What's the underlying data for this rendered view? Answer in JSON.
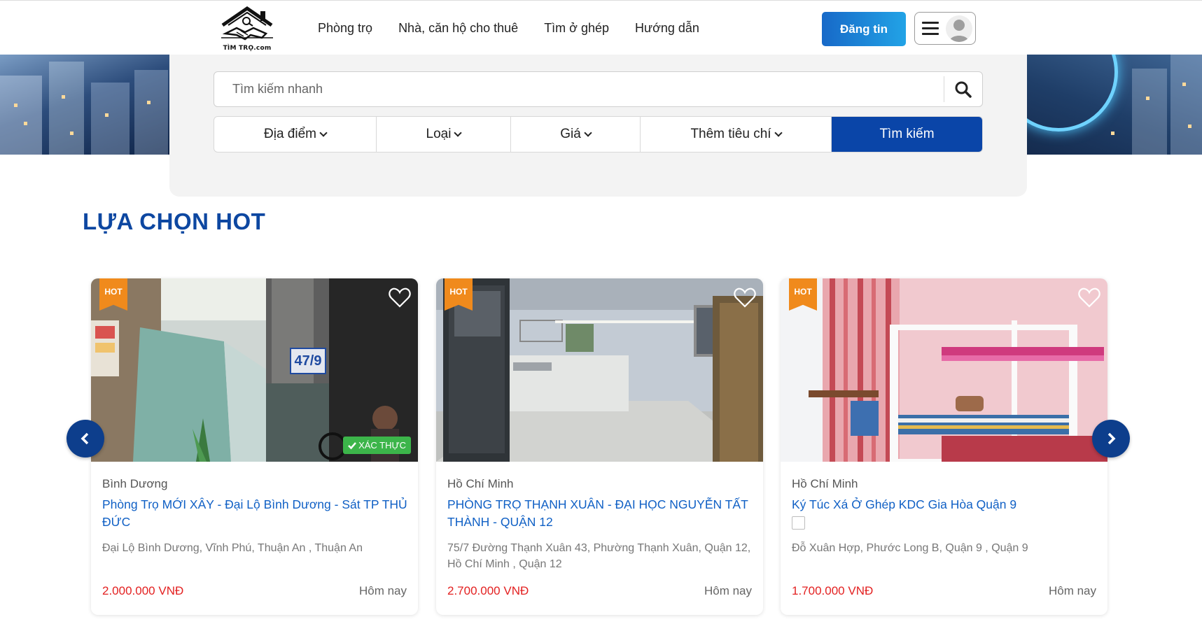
{
  "header": {
    "logo_text": "TÌM TRỌ.com",
    "nav": [
      "Phòng trọ",
      "Nhà, căn hộ cho thuê",
      "Tìm ở ghép",
      "Hướng dẫn"
    ],
    "post_button": "Đăng tin",
    "menu_icon": "hamburger-icon",
    "avatar_icon": "user-avatar-icon"
  },
  "search": {
    "placeholder": "Tìm kiếm nhanh",
    "icon": "search-icon",
    "filters": [
      "Địa điểm",
      "Loại",
      "Giá",
      "Thêm tiêu chí"
    ],
    "submit_label": "Tìm kiếm"
  },
  "section": {
    "title": "LỰA CHỌN HOT"
  },
  "carousel": {
    "prev_icon": "chevron-left-icon",
    "next_icon": "chevron-right-icon"
  },
  "listings": [
    {
      "badge": "HOT",
      "verified": "XÁC THỰC",
      "location": "Bình Dương",
      "title": "Phòng Trọ MỚI XÂY - Đại Lộ Bình Dương - Sát TP THỦ ĐỨC",
      "address": "Đại Lộ Bình Dương, Vĩnh Phú, Thuận An , Thuận An",
      "price": "2.000.000 VNĐ",
      "date": "Hôm nay"
    },
    {
      "badge": "HOT",
      "location": "Hồ Chí Minh",
      "title": "PHÒNG TRỌ THẠNH XUÂN - ĐẠI HỌC NGUYỄN TẤT THÀNH - QUẬN 12",
      "address": "75/7 Đường Thạnh Xuân 43, Phường Thạnh Xuân, Quận 12, Hồ Chí Minh , Quận 12",
      "price": "2.700.000 VNĐ",
      "date": "Hôm nay"
    },
    {
      "badge": "HOT",
      "location": "Hồ Chí Minh",
      "title": "Ký Túc Xá Ở Ghép KDC Gia Hòa Quận 9",
      "address": "Đỗ Xuân Hợp, Phước Long B, Quận 9 , Quận 9",
      "price": "1.700.000 VNĐ",
      "date": "Hôm nay"
    }
  ],
  "image_labels": {
    "house_number": "47/9"
  },
  "colors": {
    "brand_blue": "#0d47a1",
    "search_button": "#0a45a8",
    "link_blue": "#1060c5",
    "price_red": "#e32121",
    "hot_orange": "#f08a1c",
    "verified_green": "#3cb54a"
  }
}
